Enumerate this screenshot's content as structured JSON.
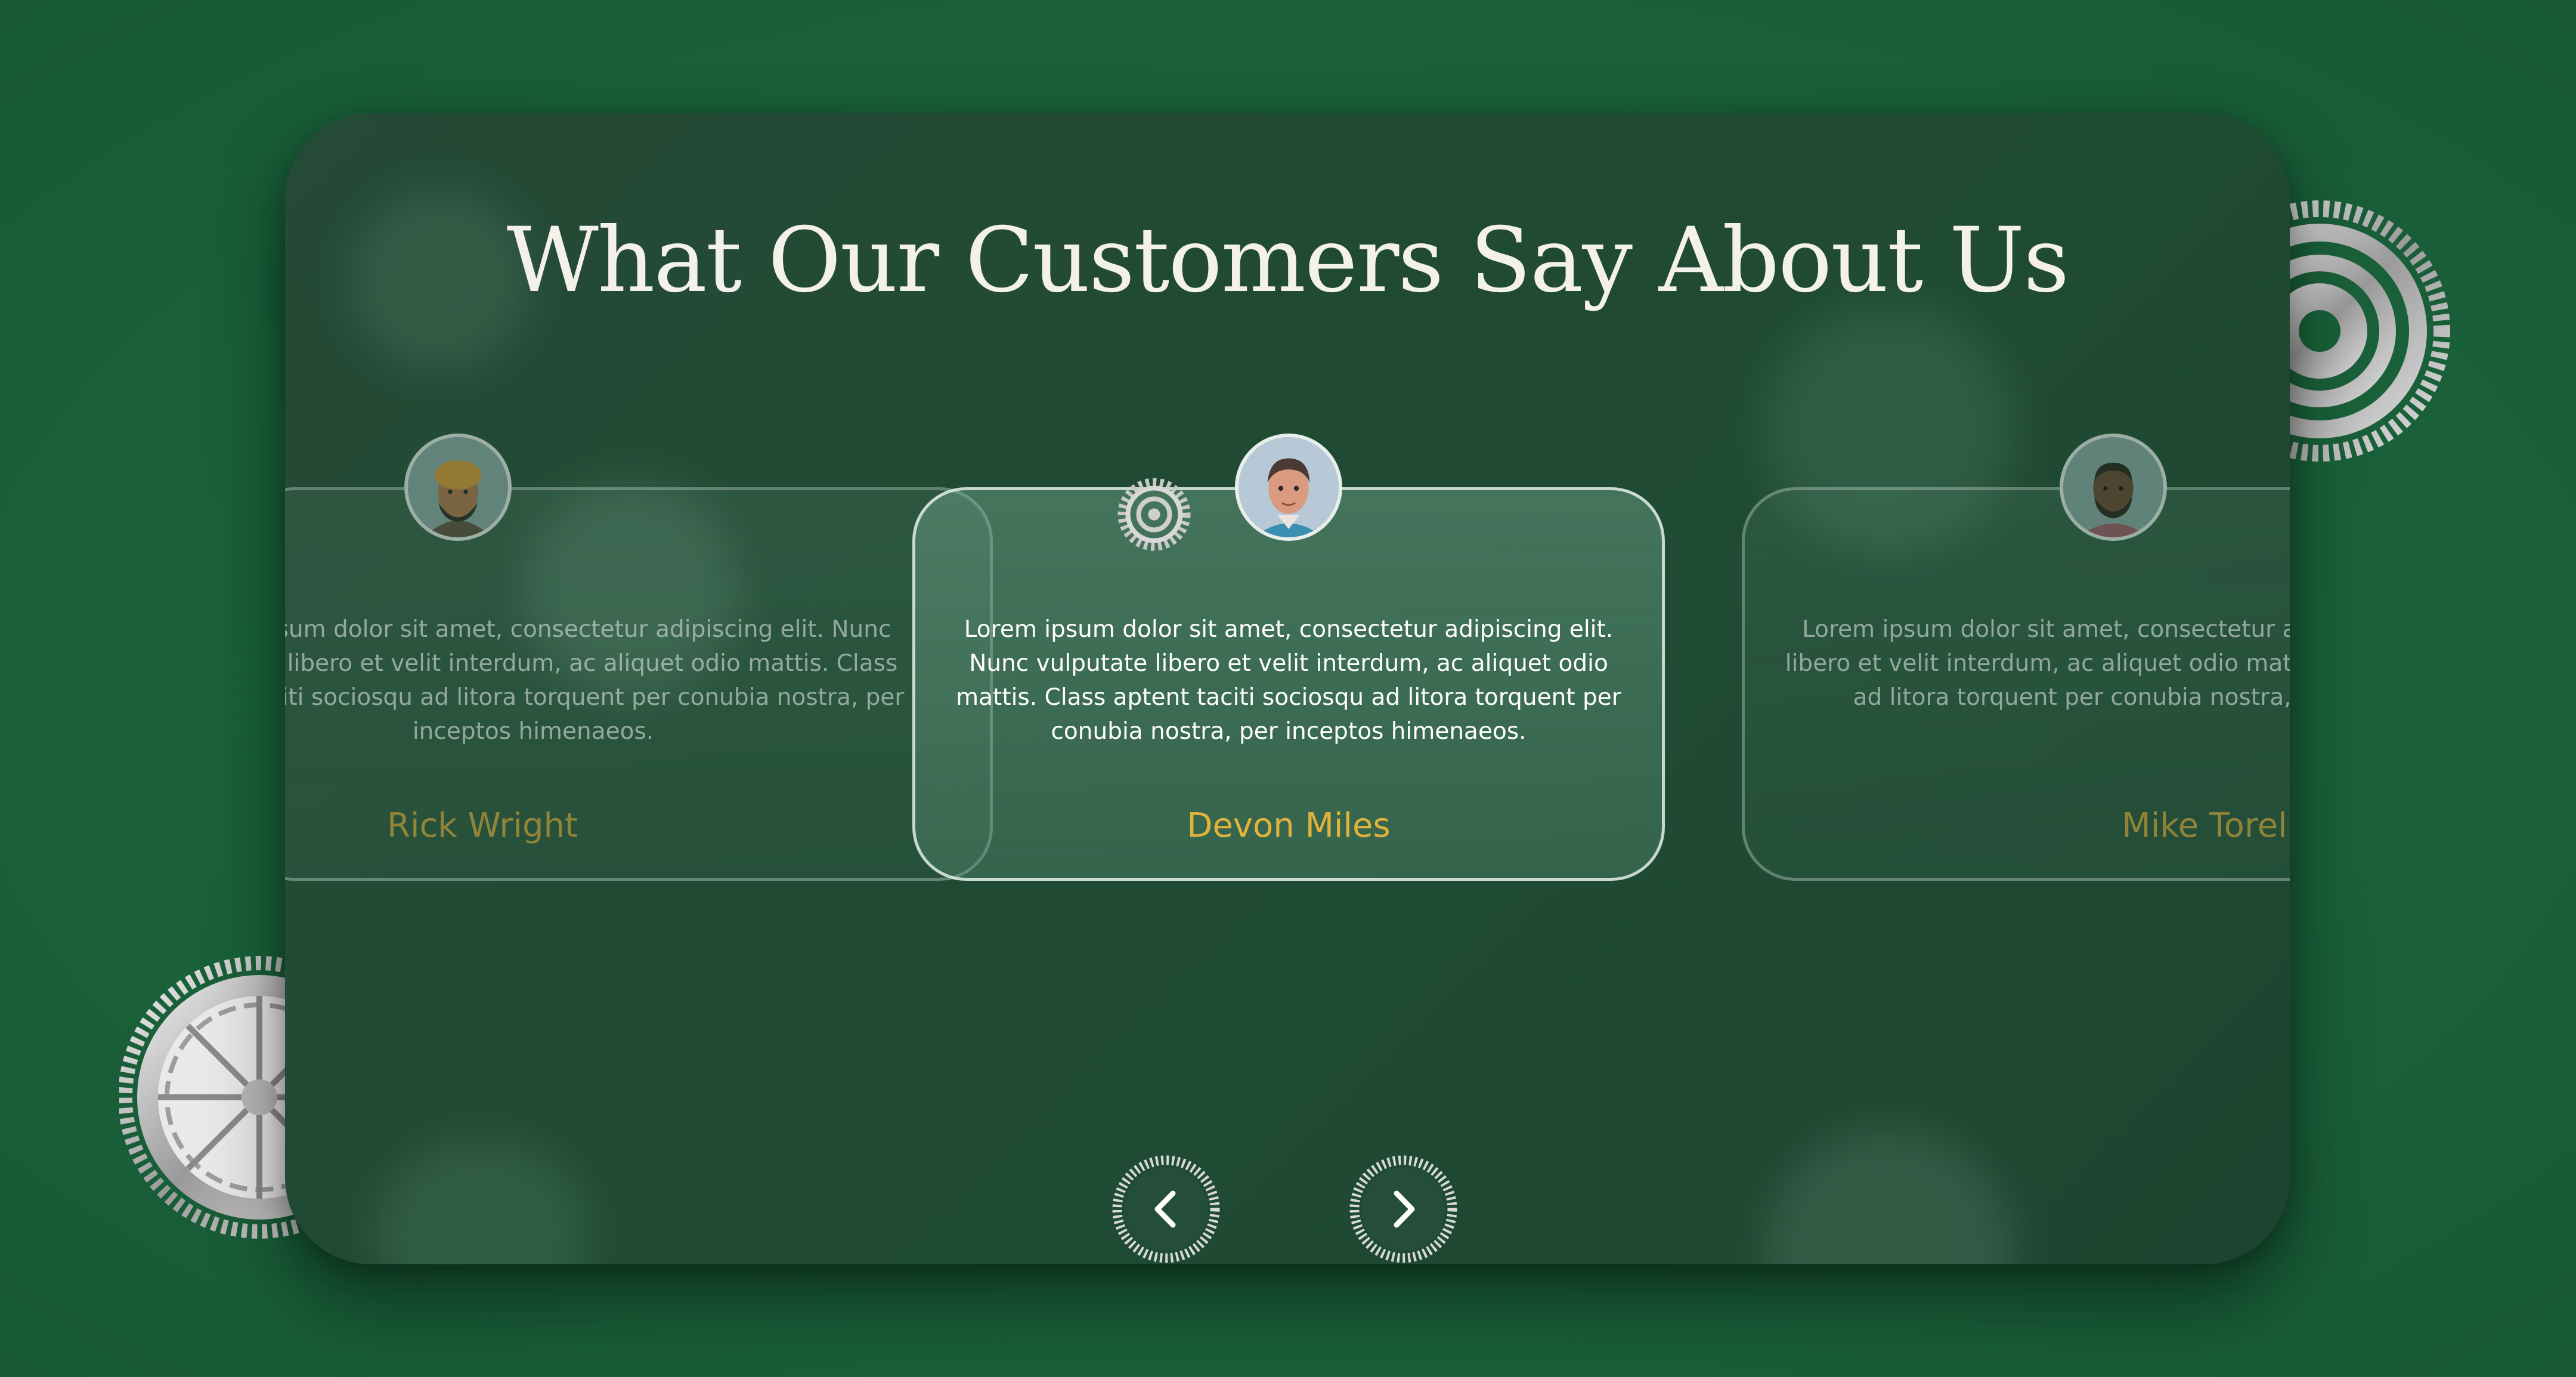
{
  "heading": "What Our Customers Say About Us",
  "testimonials": [
    {
      "position": "left",
      "quote": "Lorem ipsum dolor sit amet, consectetur adipiscing elit. Nunc vulputate libero et velit interdum, ac aliquet odio mattis. Class aptent taciti sociosqu ad litora torquent per conubia nostra, per inceptos himenaeos.",
      "name": "Rick Wright",
      "avatar": "avatar-turban-icon"
    },
    {
      "position": "center",
      "quote": "Lorem ipsum dolor sit amet, consectetur adipiscing elit. Nunc vulputate libero et velit interdum, ac aliquet odio mattis. Class aptent taciti sociosqu ad litora torquent per conubia nostra, per inceptos himenaeos.",
      "name": "Devon Miles",
      "avatar": "avatar-man-icon"
    },
    {
      "position": "right",
      "quote": "Lorem ipsum dolor sit amet, consectetur adipiscing elit. Nunc vulputate libero et velit interdum, ac aliquet odio mattis. Class aptent taciti sociosqu ad litora torquent per conubia nostra, per inceptos himenaeos.",
      "name": "Mike Torello",
      "avatar": "avatar-bearded-man-icon"
    }
  ],
  "navigation": {
    "prev_icon": "chevron-left-icon",
    "next_icon": "chevron-right-icon"
  },
  "colors": {
    "background": "#1a613a",
    "panel": "#214a34",
    "name_accent": "#e2b33a",
    "heading": "#f4f1ea"
  }
}
